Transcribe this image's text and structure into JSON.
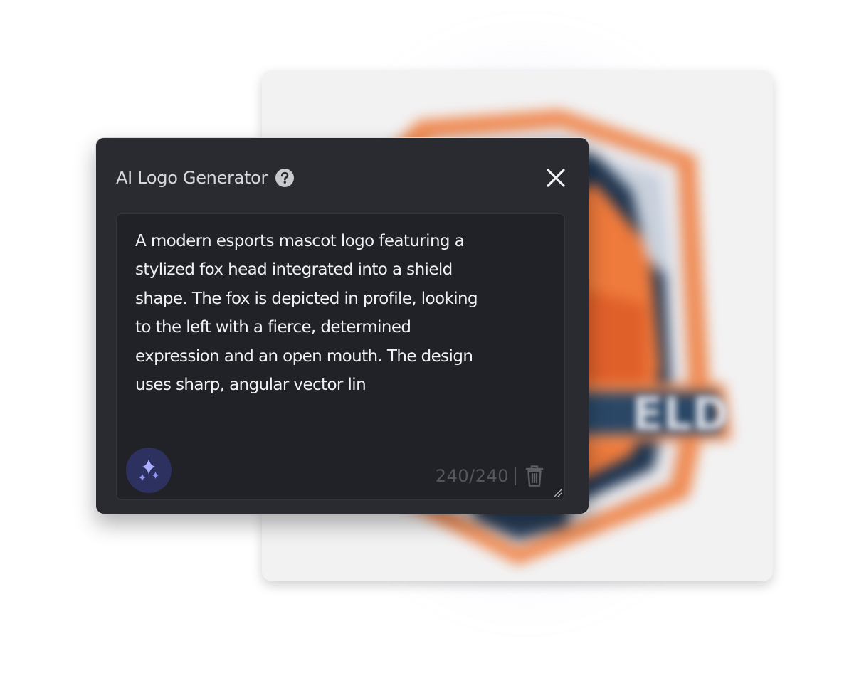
{
  "dialog": {
    "title": "AI Logo Generator",
    "help_icon": "question-circle-icon",
    "close_icon": "close-x-icon"
  },
  "prompt": {
    "text": "A modern esports mascot logo featuring a\nstylized fox head integrated into a shield\nshape. The fox is depicted in profile, looking\nto the left with a fierce, determined\nexpression and an open mouth. The design\nuses sharp, angular vector lin",
    "char_count": "240/240",
    "generate_icon": "sparkles-icon",
    "delete_icon": "trash-icon",
    "resize_icon": "resize-handle-icon"
  },
  "preview": {
    "description_icon": "blurred-shield-logo",
    "brand_text": "ELD"
  },
  "colors": {
    "dialog_bg": "#2a2b30",
    "prompt_bg": "#212227",
    "accent_button": "#2d3160",
    "sparkle": "#8f96f5",
    "char_count": "#55565d",
    "logo_orange": "#ee7a3c",
    "logo_navy": "#1f3550"
  }
}
